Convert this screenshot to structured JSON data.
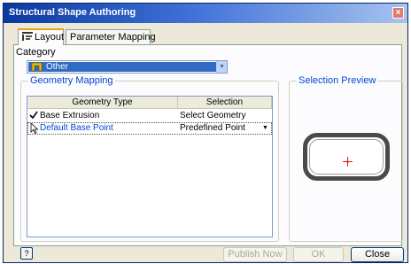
{
  "window": {
    "title": "Structural Shape Authoring"
  },
  "tabs": [
    {
      "label": "Layout",
      "icon": "layout-icon",
      "active": true
    },
    {
      "label": "Parameter Mapping",
      "active": false
    }
  ],
  "category": {
    "label": "Category",
    "value": "Other",
    "icon": "other-shape-icon"
  },
  "geometry_mapping": {
    "legend": "Geometry Mapping",
    "columns": [
      "Geometry Type",
      "Selection"
    ],
    "rows": [
      {
        "mark": "check-icon",
        "type": "Base Extrusion",
        "selection": "Select Geometry"
      },
      {
        "mark": "pointer-icon",
        "type": "Default Base Point",
        "selection": "Predefined Point",
        "has_dropdown": true
      }
    ]
  },
  "preview": {
    "legend": "Selection Preview"
  },
  "footer": {
    "help": "?",
    "publish_label": "Publish Now",
    "ok_label": "OK",
    "close_label": "Close"
  },
  "colors": {
    "accent": "#316ac5",
    "legend": "#0046d5",
    "point": "#e02020"
  }
}
